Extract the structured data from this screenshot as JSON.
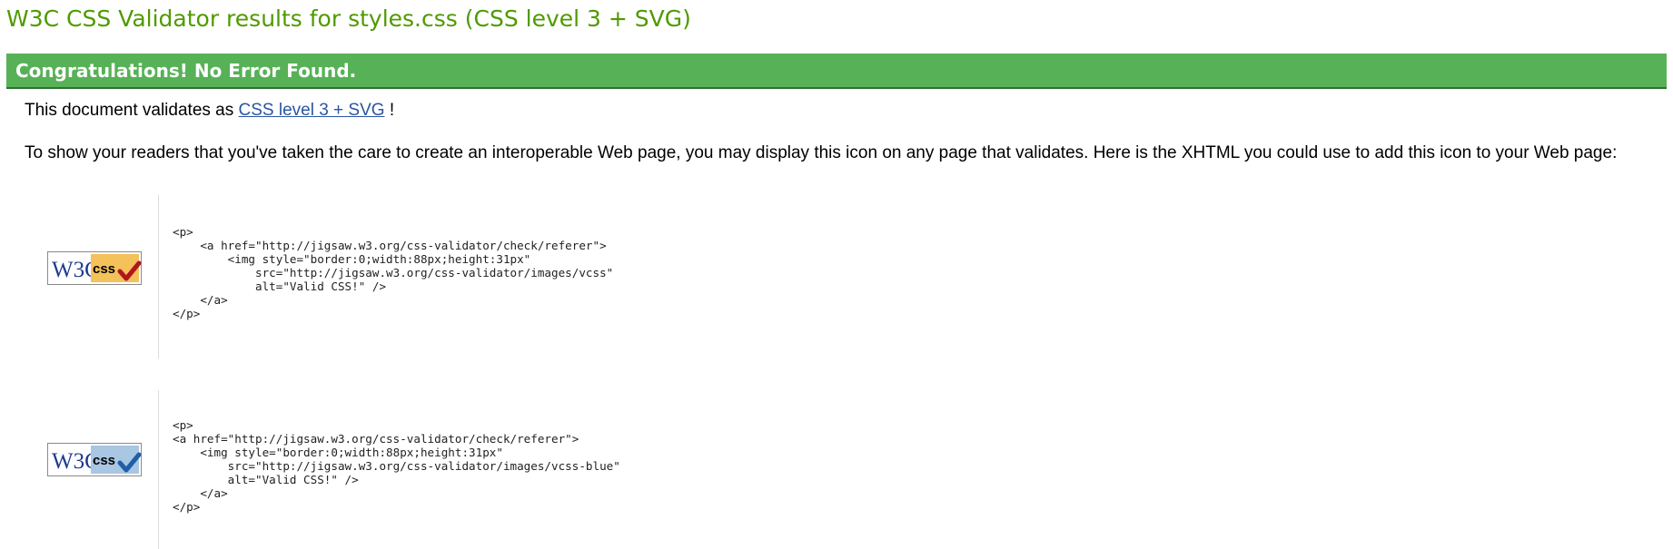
{
  "page": {
    "title": "W3C CSS Validator results for styles.css (CSS level 3 + SVG)"
  },
  "banner": {
    "text": "Congratulations! No Error Found.",
    "color": "#57b157"
  },
  "validates": {
    "prefix": "This document validates as",
    "link_text": "CSS level 3 + SVG",
    "suffix": "!"
  },
  "info": {
    "text": "To show your readers that you've taken the care to create an interoperable Web page, you may display this icon on any page that validates. Here is the XHTML you could use to add this icon to your Web page:"
  },
  "badges": [
    {
      "logo_text": "W3C",
      "css_text": "css",
      "variant": "gold",
      "check_color": "#b0161d",
      "code": "<p>\n    <a href=\"http://jigsaw.w3.org/css-validator/check/referer\">\n        <img style=\"border:0;width:88px;height:31px\"\n            src=\"http://jigsaw.w3.org/css-validator/images/vcss\"\n            alt=\"Valid CSS!\" />\n    </a>\n</p>"
    },
    {
      "logo_text": "W3C",
      "css_text": "css",
      "variant": "blue",
      "check_color": "#1f5fa6",
      "code": "<p>\n<a href=\"http://jigsaw.w3.org/css-validator/check/referer\">\n    <img style=\"border:0;width:88px;height:31px\"\n        src=\"http://jigsaw.w3.org/css-validator/images/vcss-blue\"\n        alt=\"Valid CSS!\" />\n    </a>\n</p>"
    }
  ]
}
